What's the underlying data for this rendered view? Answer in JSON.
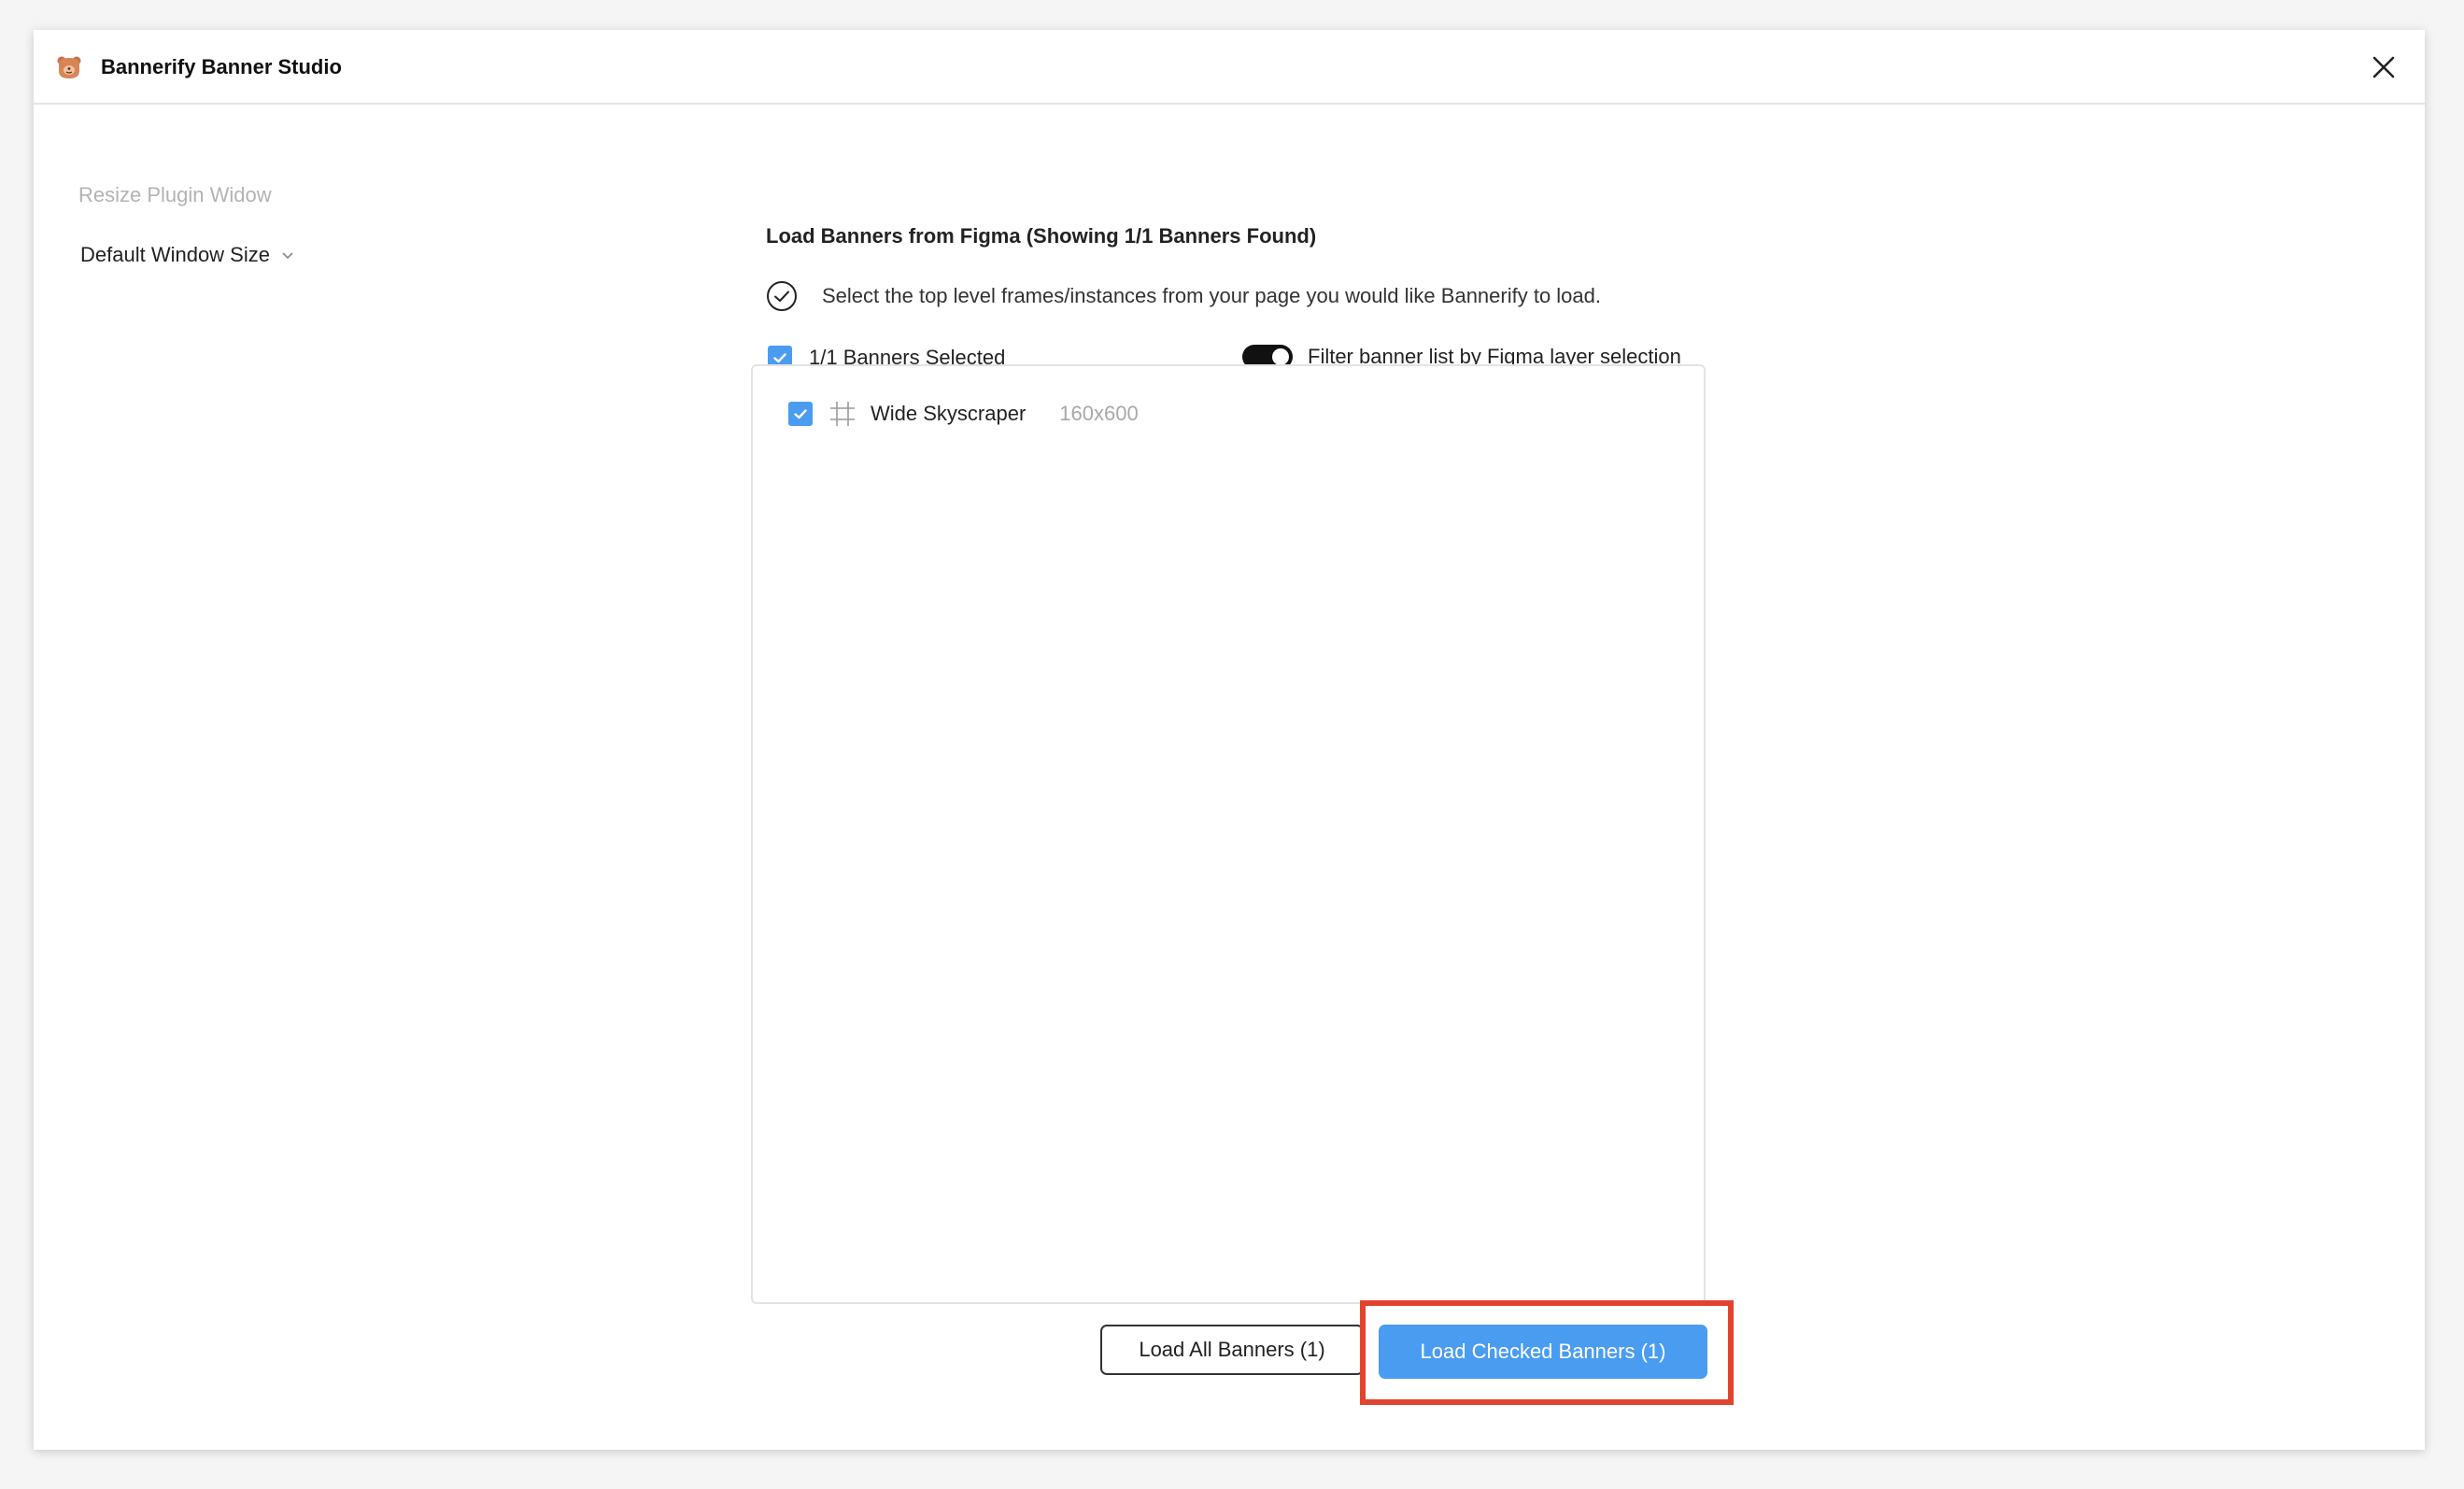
{
  "window": {
    "title": "Bannerify Banner Studio",
    "app_icon": "bear-icon",
    "close_icon": "close-icon"
  },
  "sidebar": {
    "resize_label": "Resize Plugin Widow",
    "window_size_value": "Default Window Size",
    "window_size_icon": "chevron-down-icon"
  },
  "main": {
    "section_title": "Load Banners from Figma (Showing 1/1 Banners Found)",
    "hint_icon": "check-circle-icon",
    "hint_text": "Select the top level frames/instances from your page you would like Bannerify to load.",
    "select_all": {
      "checked": true,
      "label": "1/1 Banners Selected"
    },
    "filter_toggle": {
      "on": true,
      "label": "Filter banner list by Figma layer selection"
    },
    "banners": [
      {
        "checked": true,
        "icon": "frame-icon",
        "name": "Wide Skyscraper",
        "size": "160x600"
      }
    ]
  },
  "actions": {
    "load_all_label": "Load All Banners (1)",
    "load_checked_label": "Load Checked Banners (1)"
  },
  "colors": {
    "accent": "#4a9cf0",
    "highlight": "#e2432e",
    "muted_text": "#b3b3b3"
  }
}
